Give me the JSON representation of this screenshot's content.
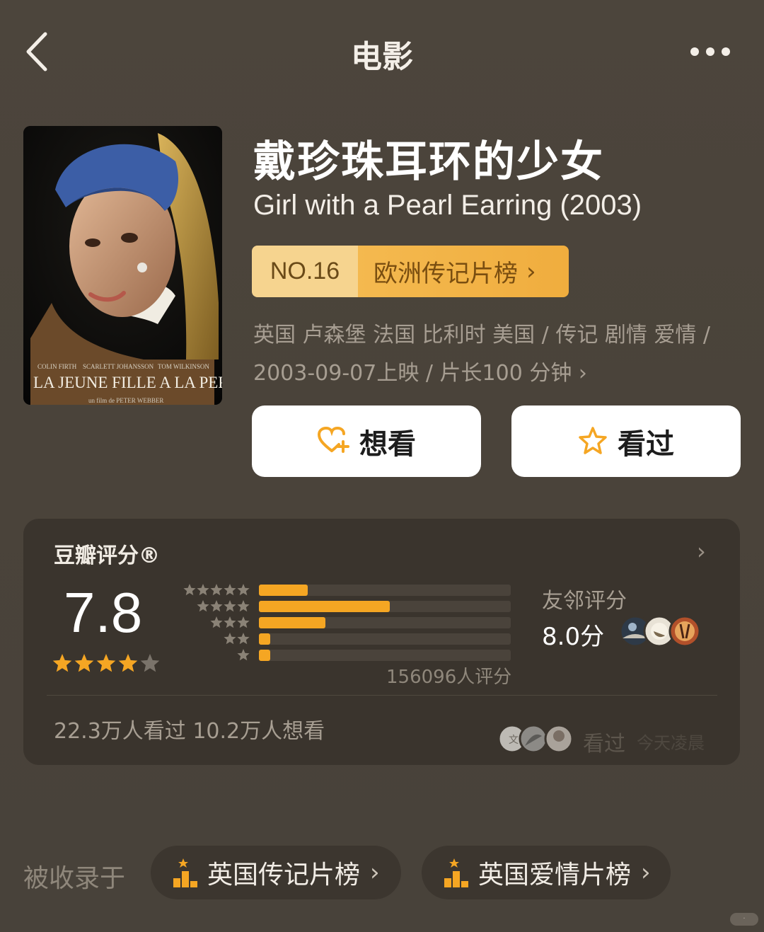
{
  "nav": {
    "title": "电影",
    "back_icon": "chevron-left-icon",
    "more_icon": "more-dots-icon"
  },
  "poster": {
    "credits": [
      "COLIN FIRTH",
      "SCARLETT JOHANSSON",
      "TOM WILKINSON"
    ],
    "title": "La Jeune Fille a la Perle",
    "director_line": "un film de PETER WEBBER"
  },
  "movie": {
    "title_cn": "戴珍珠耳环的少女",
    "title_en": "Girl with a Pearl Earring (2003)",
    "rank_no": "NO.16",
    "rank_list": "欧洲传记片榜",
    "meta_line1": "英国 卢森堡 法国 比利时 美国 / 传记 剧情 爱情 /",
    "meta_line2": "2003-09-07上映 / 片长100 分钟",
    "meta_chevron": "›"
  },
  "actions": {
    "want_label": "想看",
    "seen_label": "看过",
    "want_icon": "heart-plus-icon",
    "seen_icon": "star-outline-icon"
  },
  "rating": {
    "title": "豆瓣评分®",
    "score": "7.8",
    "stars": 4,
    "distribution_percent": [
      19.5,
      52.0,
      26.5,
      4.5,
      4.5
    ],
    "count_text": "156096人评分",
    "friends_label": "友邻评分",
    "friends_score": "8.0分",
    "stats": "22.3万人看过   10.2万人想看",
    "seen_label": "看过",
    "seen_time": "今天凌晨",
    "accent": "#f5a623"
  },
  "included": {
    "label": "被收录于",
    "chips": [
      {
        "label": "英国传记片榜",
        "icon": "ranking-podium-icon"
      },
      {
        "label": "英国爱情片榜",
        "icon": "ranking-podium-icon"
      }
    ]
  }
}
